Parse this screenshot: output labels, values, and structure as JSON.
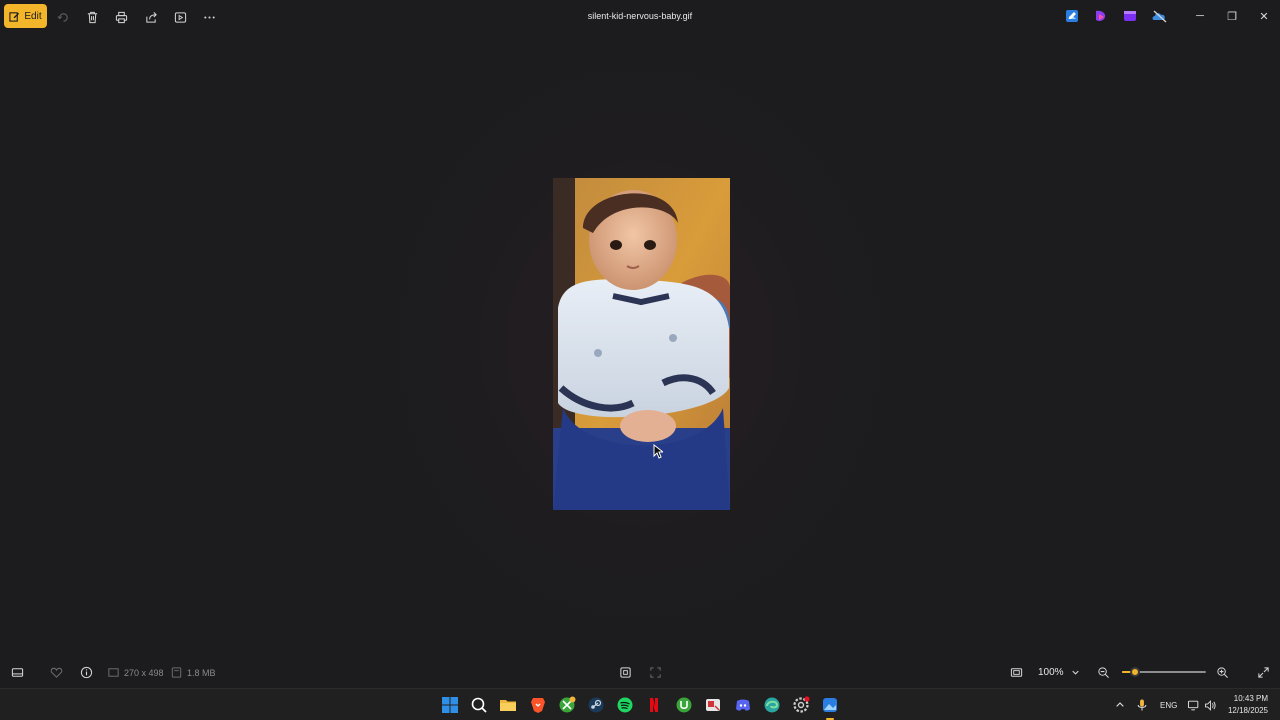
{
  "titlebar": {
    "edit_label": "Edit",
    "file_name": "silent-kid-nervous-baby.gif",
    "icons": [
      "rotate-icon",
      "delete-icon",
      "print-icon",
      "share-icon",
      "slideshow-icon",
      "more-icon"
    ],
    "window_controls": {
      "minimize": "─",
      "maximize": "❐",
      "close": "✕"
    }
  },
  "image": {
    "description_icon": "baby-photo"
  },
  "bottombar": {
    "dimensions": "270 x 498",
    "file_size": "1.8 MB",
    "zoom": "100%",
    "zoom_fraction": 0.15
  },
  "taskbar": {
    "language": "ENG",
    "time": "10:43 PM",
    "date": "12/18/2025"
  },
  "colors": {
    "accent": "#f3b62a",
    "background": "#1c1c1e",
    "taskbar": "#202020"
  }
}
